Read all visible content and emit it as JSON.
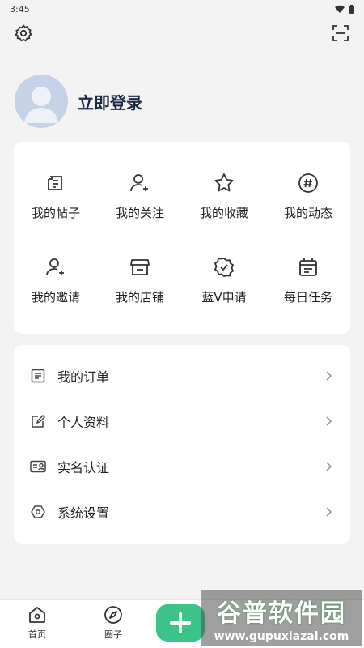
{
  "status_bar": {
    "time": "3:45"
  },
  "profile": {
    "login_label": "立即登录"
  },
  "grid": [
    {
      "label": "我的帖子",
      "icon": "post-icon"
    },
    {
      "label": "我的关注",
      "icon": "follow-icon"
    },
    {
      "label": "我的收藏",
      "icon": "star-icon"
    },
    {
      "label": "我的动态",
      "icon": "hashtag-icon"
    },
    {
      "label": "我的邀请",
      "icon": "invite-icon"
    },
    {
      "label": "我的店铺",
      "icon": "store-icon"
    },
    {
      "label": "蓝V申请",
      "icon": "verified-badge-icon"
    },
    {
      "label": "每日任务",
      "icon": "calendar-icon"
    }
  ],
  "list": [
    {
      "label": "我的订单",
      "icon": "order-icon"
    },
    {
      "label": "个人资料",
      "icon": "edit-icon"
    },
    {
      "label": "实名认证",
      "icon": "id-card-icon"
    },
    {
      "label": "系统设置",
      "icon": "hexagon-settings-icon"
    }
  ],
  "bottom_nav": {
    "home": "首页",
    "circle": "圈子"
  },
  "watermark": {
    "title": "谷普软件园",
    "url": "www.gupuxiazai.com"
  },
  "colors": {
    "accent": "#3cc38a",
    "title": "#1d2741",
    "avatar_bg": "#c6d2e7"
  }
}
